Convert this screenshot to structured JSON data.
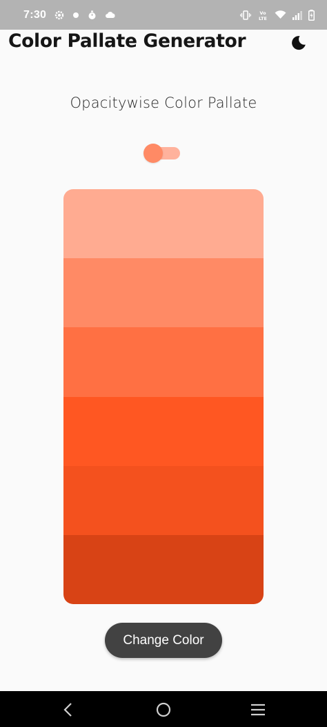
{
  "status_bar": {
    "time": "7:30",
    "left_icons": [
      "settings-gear-icon",
      "record-dot-icon",
      "timer-icon",
      "cloud-icon"
    ],
    "right_icons": [
      "vibrate-icon",
      "volte-icon",
      "wifi-icon",
      "signal-icon",
      "battery-charging-icon"
    ],
    "volte_label": "Vo LTE"
  },
  "app_bar": {
    "title": "Color Pallate Generator",
    "theme_icon": "moon-icon"
  },
  "main": {
    "subtitle": "Opacitywise Color Pallate",
    "switch_on": false,
    "switch_colors": {
      "thumb": "#ff8a65",
      "track": "#ffb29c"
    },
    "palette": [
      {
        "color": "#ffab91"
      },
      {
        "color": "#ff8a65"
      },
      {
        "color": "#ff7043"
      },
      {
        "color": "#ff5722"
      },
      {
        "color": "#f4511e"
      },
      {
        "color": "#d84315"
      }
    ],
    "button_label": "Change Color"
  },
  "nav_bar": {
    "items": [
      "back-icon",
      "home-icon",
      "recents-icon"
    ]
  }
}
